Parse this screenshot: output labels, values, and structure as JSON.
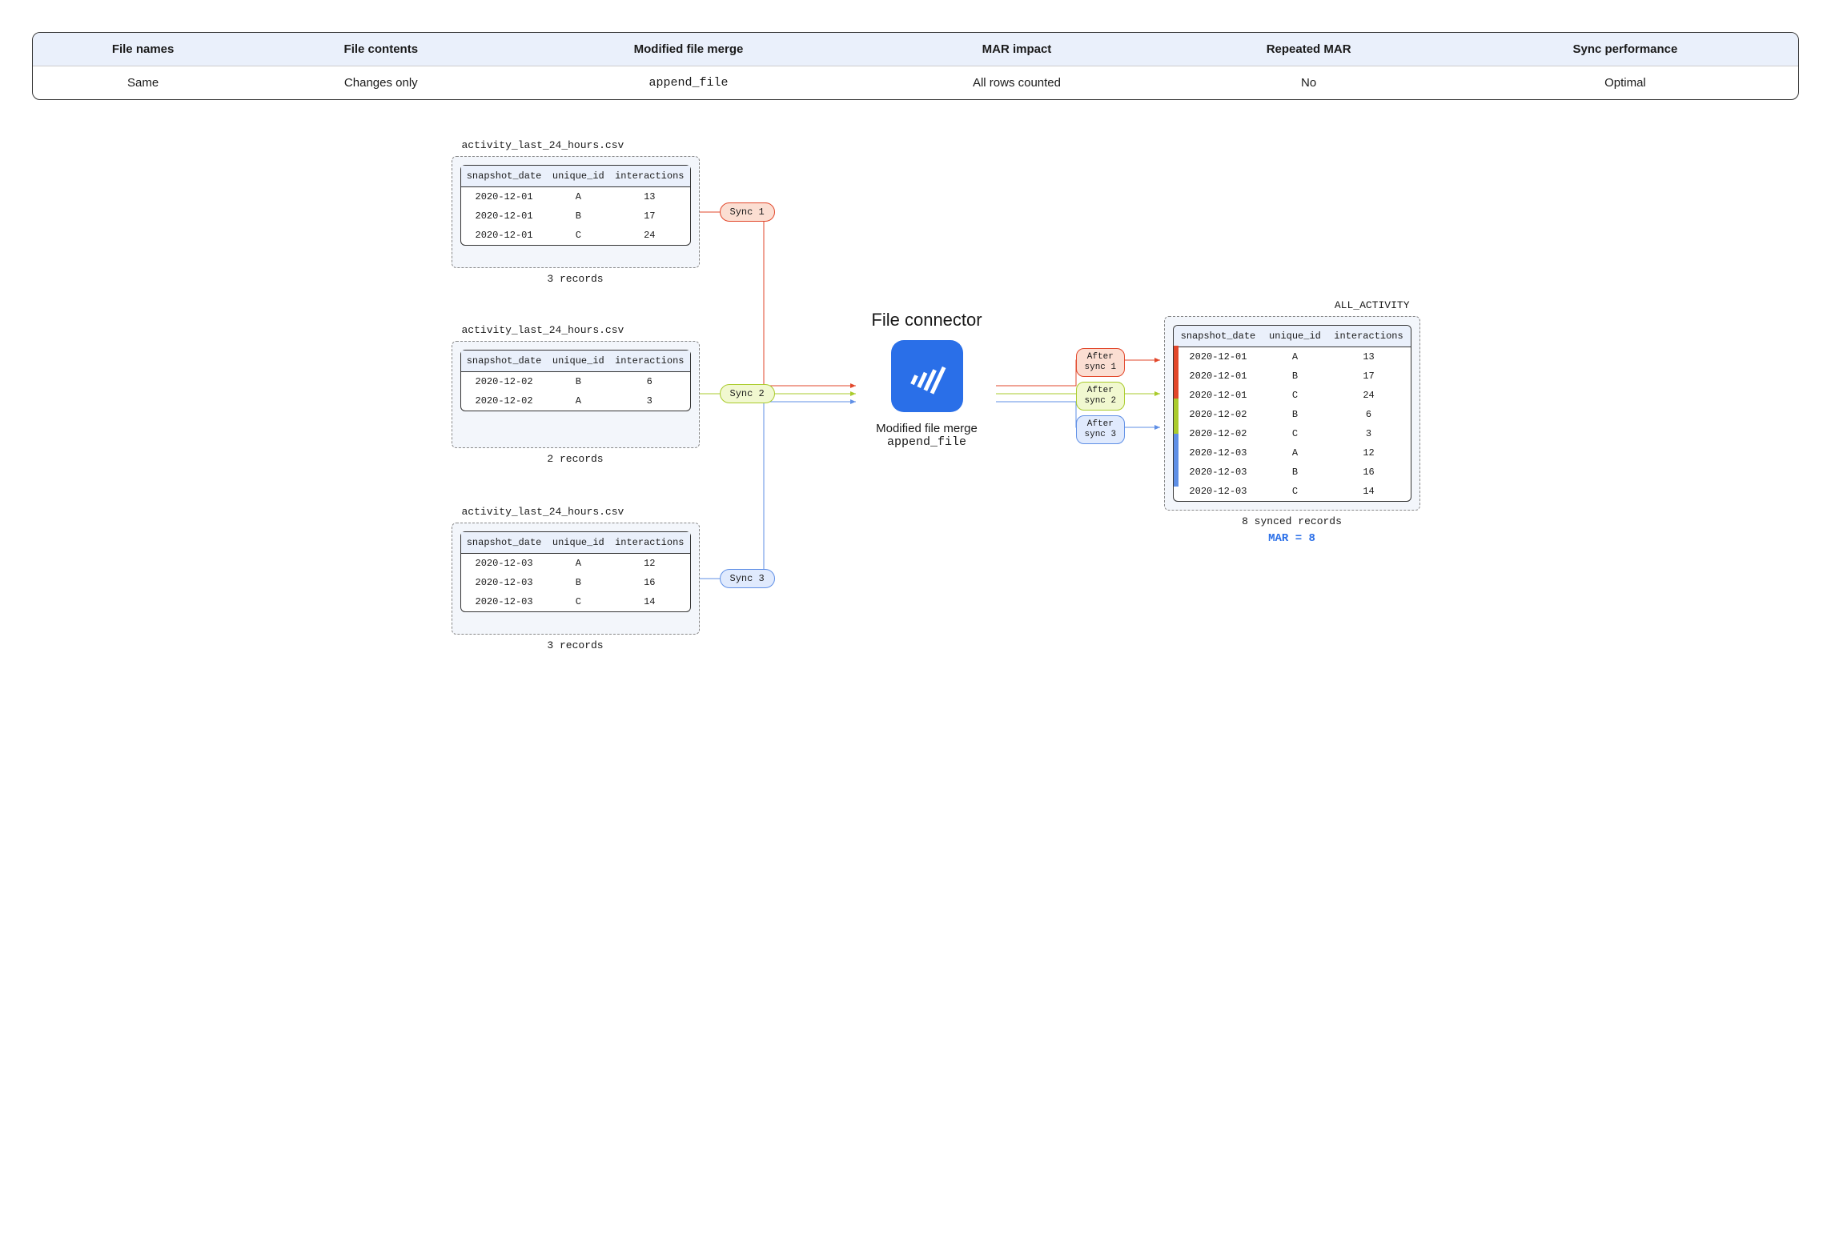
{
  "summary": {
    "headers": [
      "File names",
      "File contents",
      "Modified file merge",
      "MAR impact",
      "Repeated MAR",
      "Sync performance"
    ],
    "row": [
      "Same",
      "Changes only",
      "append_file",
      "All rows counted",
      "No",
      "Optimal"
    ]
  },
  "files": [
    {
      "label": "activity_last_24_hours.csv",
      "footer": "3 records",
      "headers": [
        "snapshot_date",
        "unique_id",
        "interactions"
      ],
      "rows": [
        [
          "2020-12-01",
          "A",
          "13"
        ],
        [
          "2020-12-01",
          "B",
          "17"
        ],
        [
          "2020-12-01",
          "C",
          "24"
        ]
      ]
    },
    {
      "label": "activity_last_24_hours.csv",
      "footer": "2 records",
      "headers": [
        "snapshot_date",
        "unique_id",
        "interactions"
      ],
      "rows": [
        [
          "2020-12-02",
          "B",
          "6"
        ],
        [
          "2020-12-02",
          "A",
          "3"
        ]
      ]
    },
    {
      "label": "activity_last_24_hours.csv",
      "footer": "3 records",
      "headers": [
        "snapshot_date",
        "unique_id",
        "interactions"
      ],
      "rows": [
        [
          "2020-12-03",
          "A",
          "12"
        ],
        [
          "2020-12-03",
          "B",
          "16"
        ],
        [
          "2020-12-03",
          "C",
          "14"
        ]
      ]
    }
  ],
  "sync_labels": [
    "Sync 1",
    "Sync 2",
    "Sync 3"
  ],
  "after_labels": [
    "After\nsync 1",
    "After\nsync 2",
    "After\nsync 3"
  ],
  "connector": {
    "title": "File connector",
    "sub1": "Modified file merge",
    "sub2": "append_file"
  },
  "output": {
    "label": "ALL_ACTIVITY",
    "headers": [
      "snapshot_date",
      "unique_id",
      "interactions"
    ],
    "rows": [
      [
        "2020-12-01",
        "A",
        "13"
      ],
      [
        "2020-12-01",
        "B",
        "17"
      ],
      [
        "2020-12-01",
        "C",
        "24"
      ],
      [
        "2020-12-02",
        "B",
        "6"
      ],
      [
        "2020-12-02",
        "C",
        "3"
      ],
      [
        "2020-12-03",
        "A",
        "12"
      ],
      [
        "2020-12-03",
        "B",
        "16"
      ],
      [
        "2020-12-03",
        "C",
        "14"
      ]
    ],
    "footer1": "8 synced records",
    "footer2": "MAR = 8"
  }
}
